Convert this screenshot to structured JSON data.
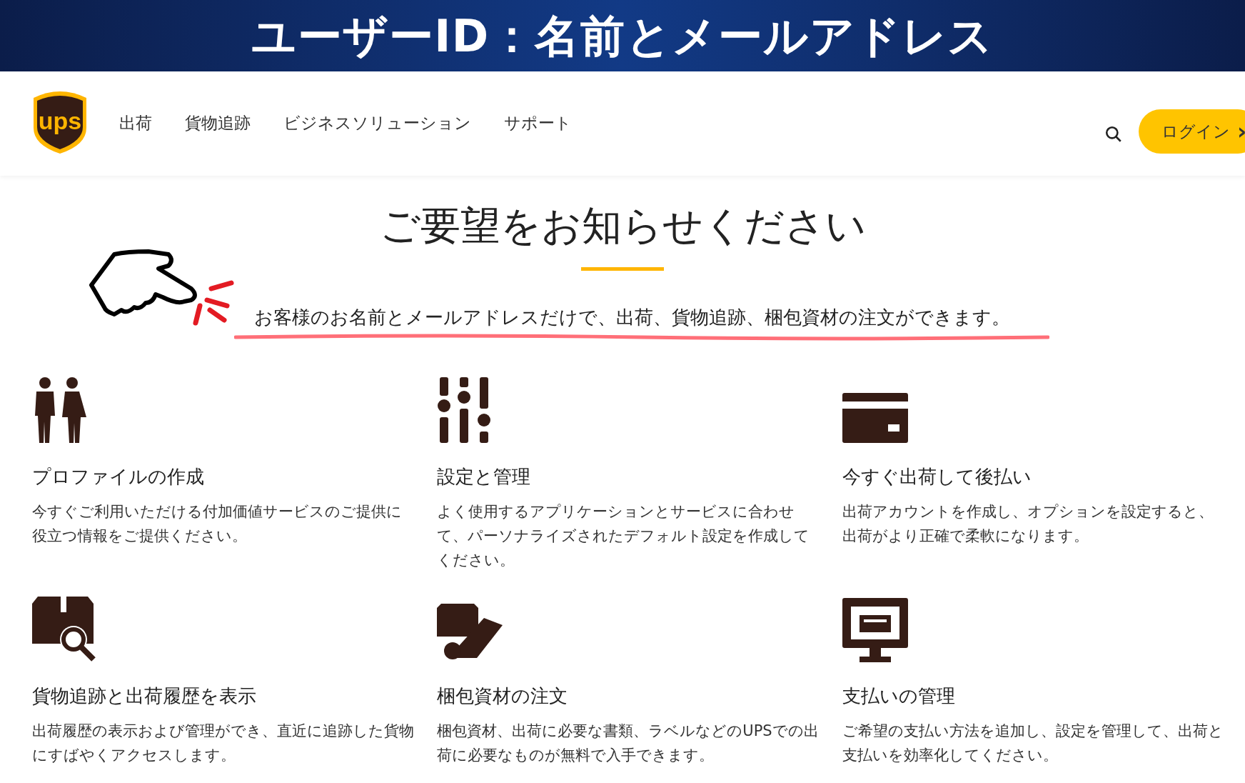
{
  "banner": {
    "title": "ユーザーID：名前とメールアドレス"
  },
  "header": {
    "logo_text": "ups",
    "nav": [
      "出荷",
      "貨物追跡",
      "ビジネスソリューション",
      "サポート"
    ],
    "login": {
      "label": "ログイン",
      "arrow": "›"
    }
  },
  "hero": {
    "heading": "ご要望をお知らせください",
    "sentence": "お客様のお名前とメールアドレスだけで、出荷、貨物追跡、梱包資材の注文ができます。"
  },
  "features": [
    {
      "title": "プロファイルの作成",
      "description": "今すぐご利用いただける付加価値サービスのご提供に役立つ情報をご提供ください。"
    },
    {
      "title": "設定と管理",
      "description": "よく使用するアプリケーションとサービスに合わせて、パーソナライズされたデフォルト設定を作成してください。"
    },
    {
      "title": "今すぐ出荷して後払い",
      "description": "出荷アカウントを作成し、オプションを設定すると、出荷がより正確で柔軟になります。"
    },
    {
      "title": "貨物追跡と出荷履歴を表示",
      "description": "出荷履歴の表示および管理ができ、直近に追跡した貨物にすばやくアクセスします。"
    },
    {
      "title": "梱包資材の注文",
      "description": "梱包資材、出荷に必要な書類、ラベルなどのUPSでの出荷に必要なものが無料で入手できます。"
    },
    {
      "title": "支払いの管理",
      "description": "ご希望の支払い方法を追加し、設定を管理して、出荷と支払いを効率化してください。"
    }
  ]
}
